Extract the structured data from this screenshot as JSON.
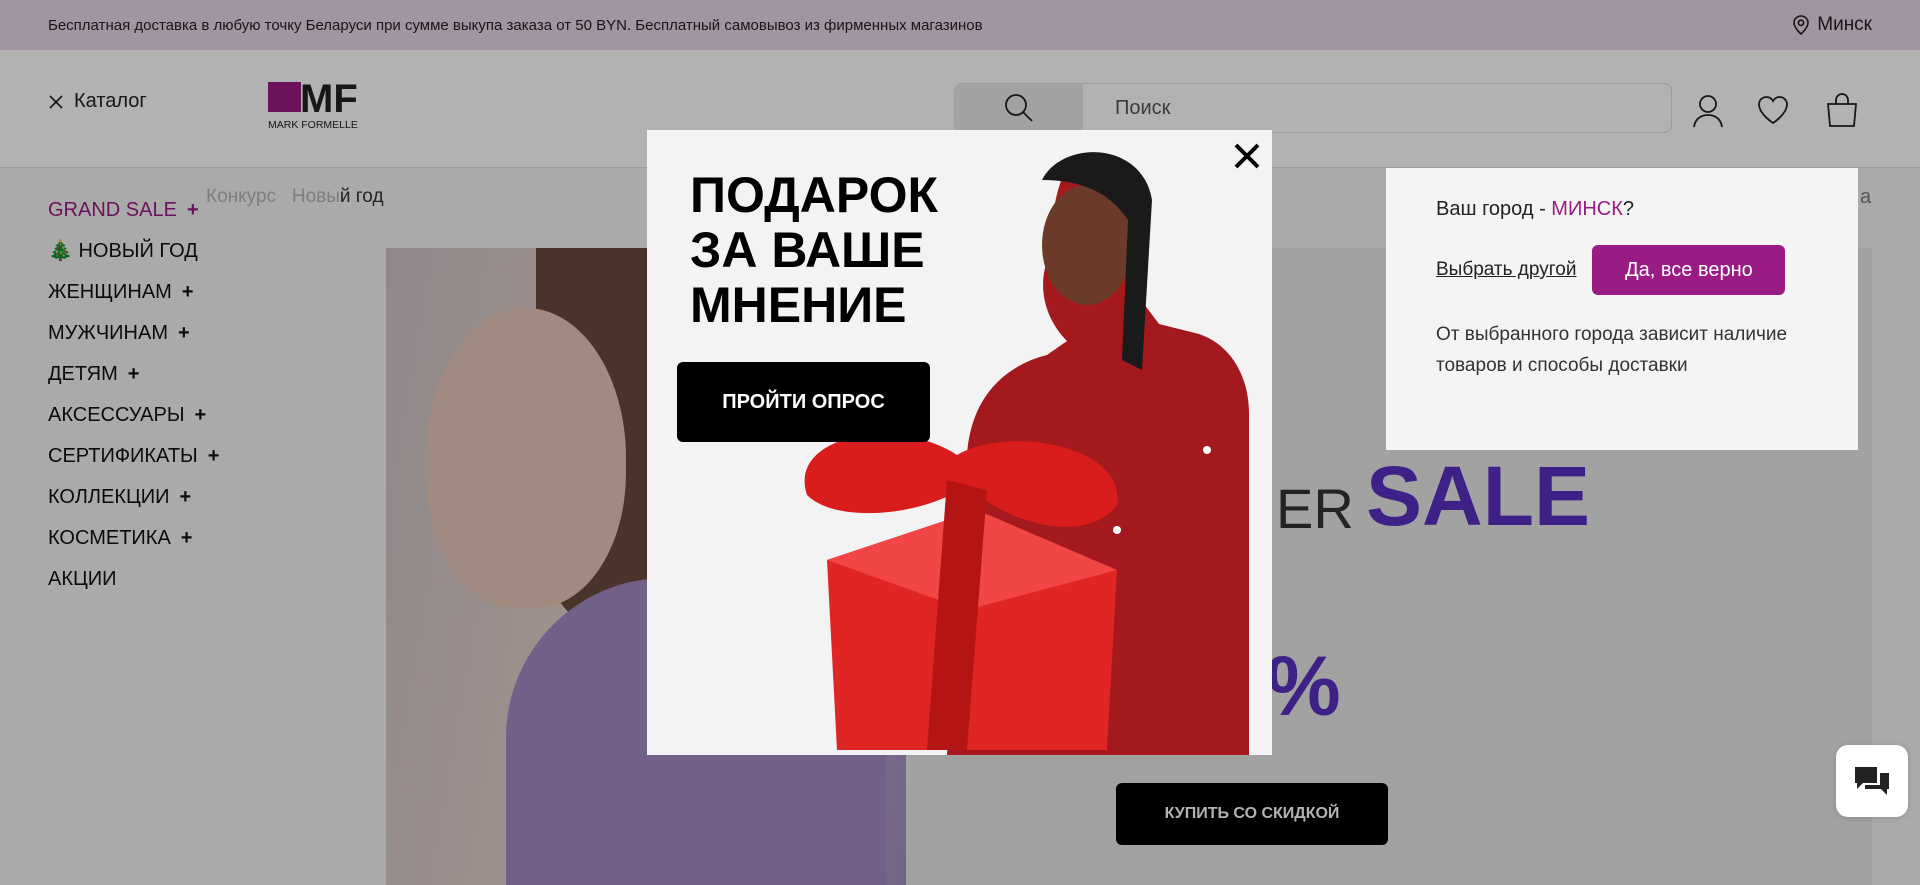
{
  "topbar": {
    "text": "Бесплатная доставка в любую точку Беларуси при сумме выкупа заказа от 50 BYN. Бесплатный самовывоз из фирменных магазинов",
    "city": "Минск"
  },
  "header": {
    "catalog_label": "Каталог",
    "logo_text": "MF",
    "logo_sub": "MARK FORMELLE",
    "search_placeholder": "Поиск"
  },
  "breadcrumbs": {
    "item1": "Конкурс",
    "item2_faded": "Новы",
    "item2_dark": "й год"
  },
  "menu": {
    "items": [
      {
        "label": "GRAND SALE",
        "plus": "+"
      },
      {
        "label": "🎄 НОВЫЙ ГОД",
        "plus": ""
      },
      {
        "label": "ЖЕНЩИНАМ",
        "plus": "+"
      },
      {
        "label": "МУЖЧИНАМ",
        "plus": "+"
      },
      {
        "label": "ДЕТЯМ",
        "plus": "+"
      },
      {
        "label": "АКСЕССУАРЫ",
        "plus": "+"
      },
      {
        "label": "СЕРТИФИКАТЫ",
        "plus": "+"
      },
      {
        "label": "КОЛЛЕКЦИИ",
        "plus": "+"
      },
      {
        "label": "КОСМЕТИКА",
        "plus": "+"
      },
      {
        "label": "АКЦИИ",
        "plus": ""
      }
    ]
  },
  "hero": {
    "er": "ER",
    "sale": "SALE",
    "pct": "%",
    "buy_label": "КУПИТЬ СО СКИДКОЙ"
  },
  "city_popup": {
    "question_prefix": "Ваш город - ",
    "city": "МИНСК",
    "question_suffix": "?",
    "other_label": "Выбрать другой",
    "confirm_label": "Да, все верно",
    "note": "От выбранного города зависит наличие товаров и способы доставки",
    "cutoff": "а"
  },
  "promo": {
    "title": "ПОДАРОК\nЗА ВАШЕ\nМНЕНИЕ",
    "survey_label": "ПРОЙТИ ОПРОС"
  },
  "colors": {
    "brand": "#9b1b84",
    "sale_accent": "#5b2fc2"
  }
}
